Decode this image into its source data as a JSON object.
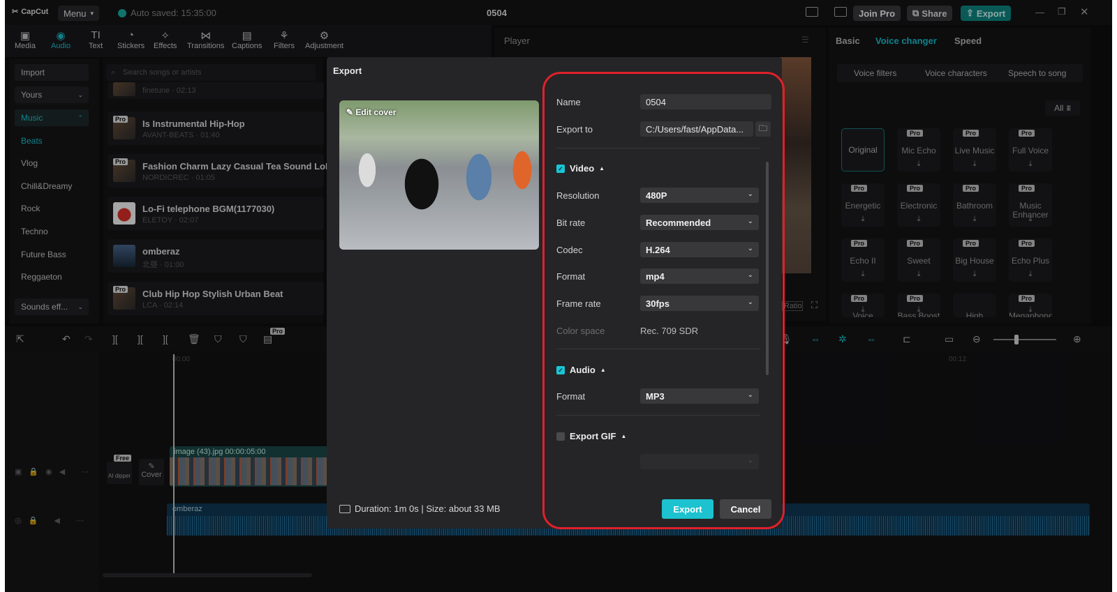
{
  "app": {
    "logo": "CapCut",
    "menu_label": "Menu",
    "autosave": "Auto saved: 15:35:00",
    "project_title": "0504",
    "join_pro": "Join Pro",
    "share": "Share",
    "export": "Export"
  },
  "toolbar": {
    "tools": [
      "Media",
      "Audio",
      "Text",
      "Stickers",
      "Effects",
      "Transitions",
      "Captions",
      "Filters",
      "Adjustment"
    ],
    "active": "Audio"
  },
  "sidebar": {
    "import": "Import",
    "yours": "Yours",
    "music": "Music",
    "items": [
      "Beats",
      "Vlog",
      "Chill&Dreamy",
      "Rock",
      "Techno",
      "Future Bass",
      "Reggaeton"
    ],
    "sounds": "Sounds eff..."
  },
  "music": {
    "search_placeholder": "Search songs or artists",
    "tracks": [
      {
        "title": "",
        "sub": "finetune · 02:13",
        "pro": false
      },
      {
        "title": "Is Instrumental Hip-Hop",
        "sub": "AVANT-BEATS · 01:40",
        "pro": true
      },
      {
        "title": "Fashion Charm Lazy Casual Tea Sound LoFi",
        "sub": "NORDICREC · 01:05",
        "pro": true
      },
      {
        "title": "Lo-Fi telephone BGM(1177030)",
        "sub": "ELETOY · 02:07",
        "pro": false
      },
      {
        "title": "omberaz",
        "sub": "北昼 · 01:00",
        "pro": false
      },
      {
        "title": "Club Hip Hop Stylish Urban Beat",
        "sub": "LCA · 02:14",
        "pro": true
      }
    ],
    "pro_label": "Pro"
  },
  "player": {
    "title": "Player",
    "ratio": "Ratio"
  },
  "right_panel": {
    "tabs": [
      "Basic",
      "Voice changer",
      "Speed"
    ],
    "active_tab": "Voice changer",
    "voice_tabs": [
      "Voice filters",
      "Voice characters",
      "Speech to song"
    ],
    "all_label": "All",
    "voices": [
      {
        "name": "Original",
        "pro": false
      },
      {
        "name": "Mic Echo",
        "pro": true
      },
      {
        "name": "Live Music",
        "pro": true
      },
      {
        "name": "Full Voice",
        "pro": true
      },
      {
        "name": "Energetic",
        "pro": true
      },
      {
        "name": "Electronic",
        "pro": true
      },
      {
        "name": "Bathroom",
        "pro": true
      },
      {
        "name": "Music Enhancer",
        "pro": true
      },
      {
        "name": "Echo II",
        "pro": true
      },
      {
        "name": "Sweet",
        "pro": true
      },
      {
        "name": "Big House",
        "pro": true
      },
      {
        "name": "Echo Plus",
        "pro": true
      },
      {
        "name": "Voice Crisper",
        "pro": true
      },
      {
        "name": "Bass Boost",
        "pro": true
      },
      {
        "name": "High",
        "pro": false
      },
      {
        "name": "Megaphone",
        "pro": true
      }
    ]
  },
  "timeline": {
    "ruler_start": "00:00",
    "ruler_mark": "00:12",
    "video_clip": "image (43).jpg  00:00:05:00",
    "audio_clip": "omberaz",
    "cover": "Cover",
    "free": "Free",
    "ai_dipper": "AI dipper",
    "pro": "Pro"
  },
  "export_dialog": {
    "title": "Export",
    "edit_cover": "Edit cover",
    "name_label": "Name",
    "name_value": "0504",
    "export_to_label": "Export to",
    "export_to_value": "C:/Users/fast/AppData...",
    "video_section": "Video",
    "video_checked": true,
    "resolution_label": "Resolution",
    "resolution_value": "480P",
    "bitrate_label": "Bit rate",
    "bitrate_value": "Recommended",
    "codec_label": "Codec",
    "codec_value": "H.264",
    "format_label": "Format",
    "format_value": "mp4",
    "framerate_label": "Frame rate",
    "framerate_value": "30fps",
    "colorspace_label": "Color space",
    "colorspace_value": "Rec. 709 SDR",
    "audio_section": "Audio",
    "audio_checked": true,
    "audio_format_label": "Format",
    "audio_format_value": "MP3",
    "gif_section": "Export GIF",
    "gif_checked": false,
    "duration": "Duration: 1m 0s | Size: about 33 MB",
    "export_button": "Export",
    "cancel_button": "Cancel"
  },
  "colors": {
    "accent": "#1cc2cf",
    "highlight": "#e0202a"
  }
}
